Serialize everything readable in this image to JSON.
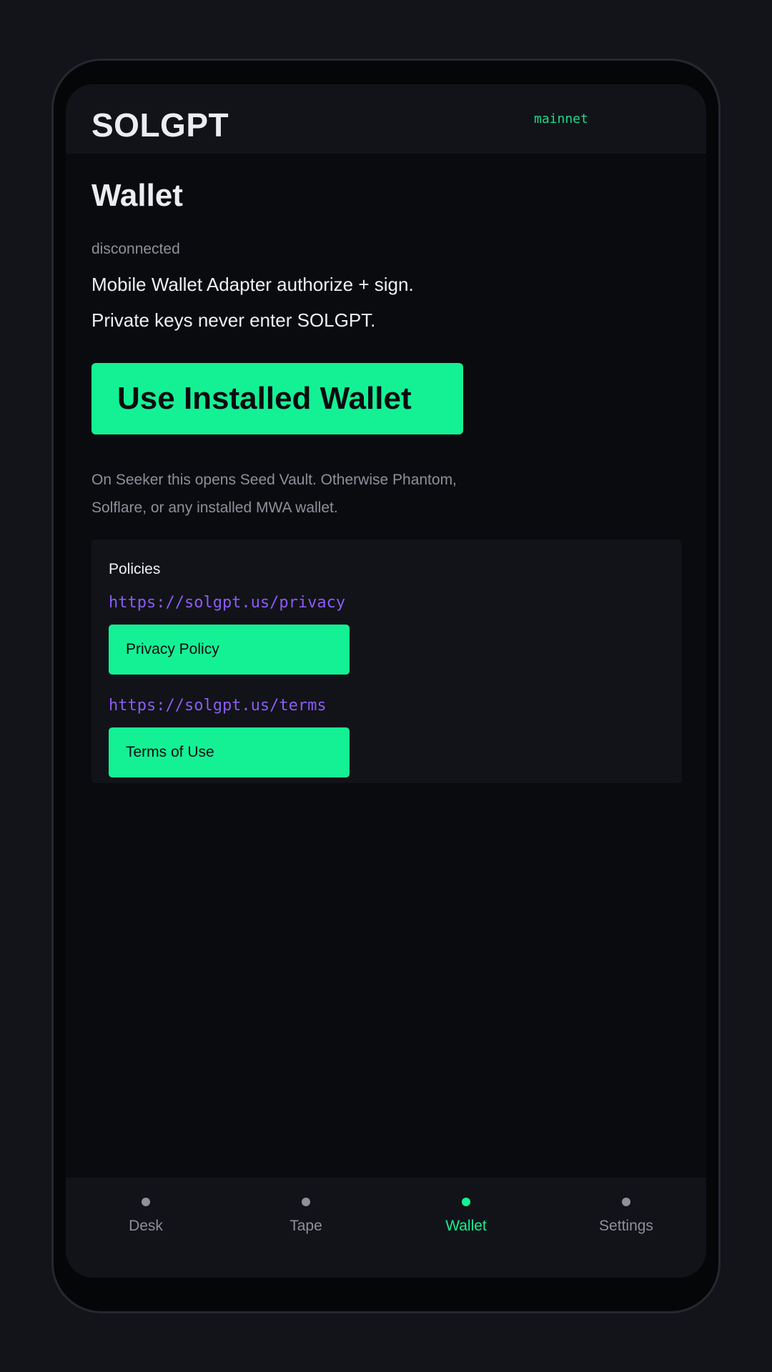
{
  "header": {
    "brand": "SOLGPT",
    "network": "mainnet"
  },
  "wallet": {
    "title": "Wallet",
    "status": "disconnected",
    "description_lines": [
      "Mobile Wallet Adapter authorize + sign.",
      "Private keys never enter SOLGPT."
    ],
    "connect_button": "Use Installed Wallet",
    "hint": "On Seeker this opens Seed Vault. Otherwise Phantom, Solflare, or any installed MWA wallet."
  },
  "policies": {
    "title": "Policies",
    "items": [
      {
        "url": "https://solgpt.us/privacy",
        "button": "Privacy Policy"
      },
      {
        "url": "https://solgpt.us/terms",
        "button": "Terms of Use"
      }
    ]
  },
  "nav": {
    "items": [
      {
        "label": "Desk"
      },
      {
        "label": "Tape"
      },
      {
        "label": "Wallet"
      },
      {
        "label": "Settings"
      }
    ],
    "active": "Wallet"
  },
  "colors": {
    "accent": "#14f195",
    "link": "#8b5cf6",
    "background": "#0a0b0f"
  }
}
